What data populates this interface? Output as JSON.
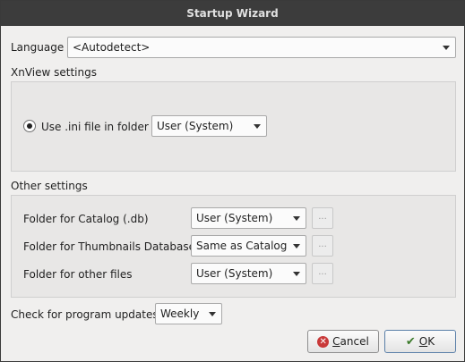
{
  "window": {
    "title": "Startup Wizard"
  },
  "language": {
    "label": "Language",
    "value": "<Autodetect>"
  },
  "xnview_settings": {
    "header": "XnView settings",
    "radio_label": "Use .ini file in folder",
    "radio_checked": true,
    "folder_value": "User (System)"
  },
  "other_settings": {
    "header": "Other settings",
    "rows": [
      {
        "label": "Folder for Catalog (.db)",
        "value": "User (System)",
        "button": "..."
      },
      {
        "label": "Folder for Thumbnails Database",
        "value": "Same as Catalog",
        "button": "..."
      },
      {
        "label": "Folder for other files",
        "value": "User (System)",
        "button": "..."
      }
    ]
  },
  "updates": {
    "label": "Check for program updates",
    "value": "Weekly"
  },
  "buttons": {
    "cancel_mnemonic": "C",
    "cancel_rest": "ancel",
    "ok_mnemonic": "O",
    "ok_rest": "K"
  },
  "icons": {
    "cancel": "cancel-icon",
    "ok": "checkmark-icon",
    "dropdown": "chevron-down-icon"
  },
  "colors": {
    "titlebar": "#3c3c3c",
    "cancel_icon": "#c93a3a",
    "ok_icon": "#3b7a2a"
  }
}
